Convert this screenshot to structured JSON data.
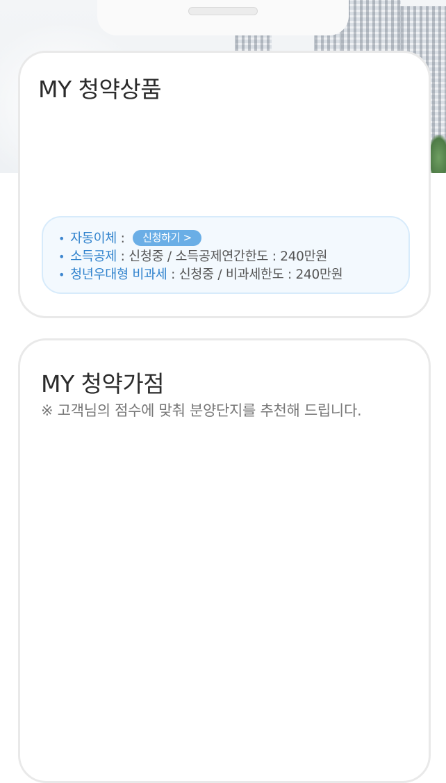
{
  "subscription_products": {
    "title": "MY 청약상품",
    "auto_transfer": {
      "label": "자동이체",
      "sep": " : ",
      "button": "신청하기 >"
    },
    "income_deduction": {
      "label": "소득공제",
      "value": " : 신청중 / 소득공제연간한도 : 240만원"
    },
    "youth_taxfree": {
      "label": "청년우대형 비과세",
      "value": " : 신청중 / 비과세한도 : 240만원"
    }
  },
  "subscription_score": {
    "title": "MY 청약가점",
    "subtitle": "※ 고객님의 점수에 맞춰 분양단지를 추천해 드립니다."
  },
  "bullet_glyph": "•",
  "colors": {
    "accent_blue": "#2f82cd",
    "button_blue": "#6aaee6",
    "info_bg": "#f3f9fe",
    "card_border": "#e9e9e9"
  }
}
